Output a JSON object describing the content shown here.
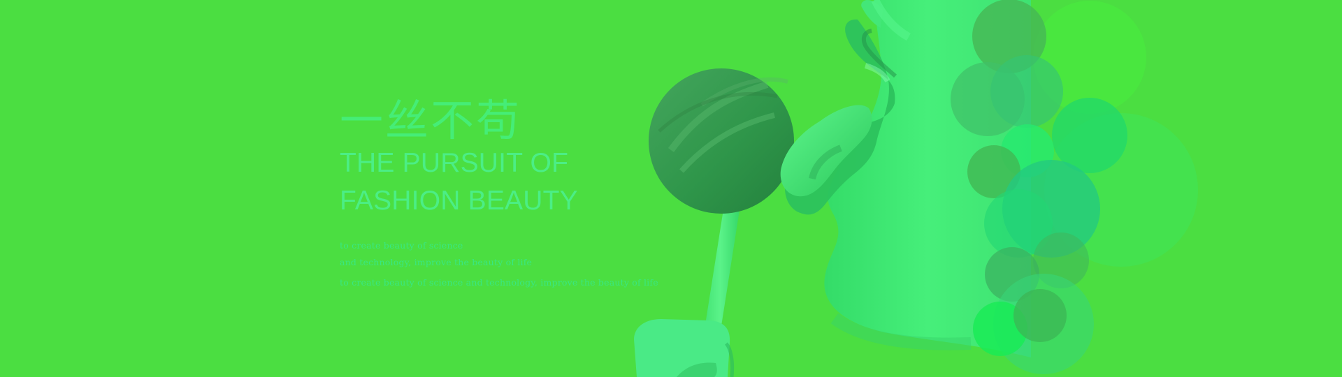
{
  "banner": {
    "cn_title": "一丝不苟",
    "en_title_line_1": "THE PURSUIT OF",
    "en_title_line_2": "FASHION BEAUTY",
    "sub_line_1": "to create beauty of science",
    "sub_line_2": "and technology, improve the beauty of life",
    "sub_line_3": "to create beauty of science and technology, improve the beauty of life"
  },
  "colors": {
    "background": "#4bde41",
    "text": "#42ea72",
    "lollipop": "#2f9d4c",
    "face": "#43ec7a",
    "bubble": "#33c870"
  },
  "illustration": {
    "subjects": [
      "lollipop-icon",
      "face-icon",
      "bubbles-icon"
    ]
  }
}
